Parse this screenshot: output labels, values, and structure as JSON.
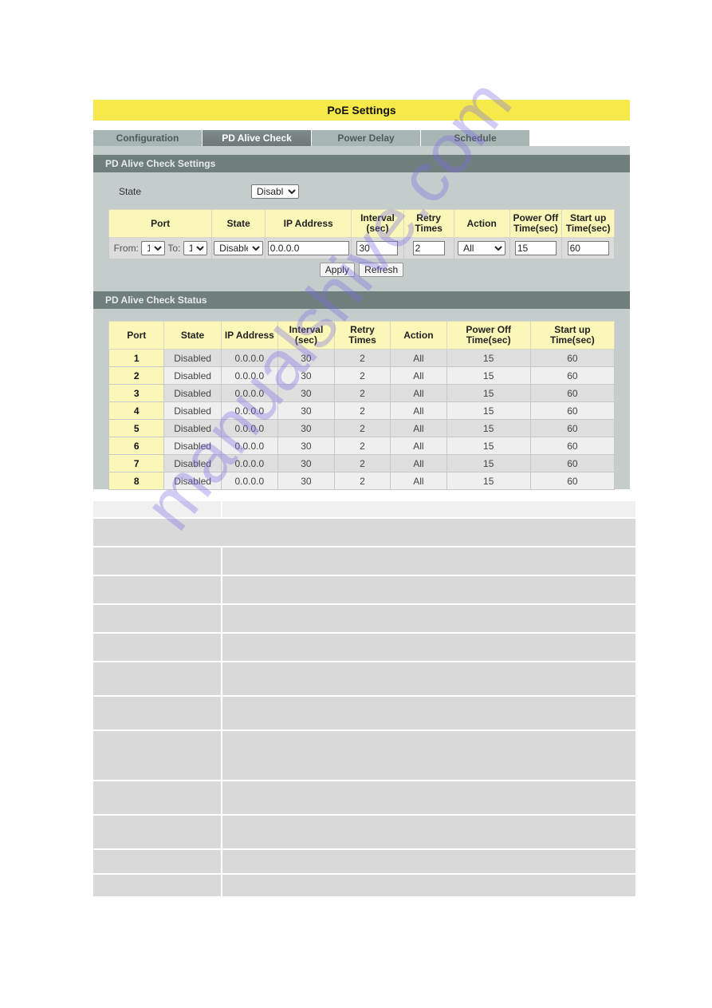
{
  "page": {
    "title": "PoE Settings"
  },
  "tabs": [
    {
      "label": "Configuration",
      "active": false
    },
    {
      "label": "PD Alive Check",
      "active": true
    },
    {
      "label": "Power Delay",
      "active": false
    },
    {
      "label": "Schedule",
      "active": false
    }
  ],
  "settings": {
    "header": "PD Alive Check Settings",
    "state_label": "State",
    "state_value": "Disable",
    "columns": [
      "Port",
      "State",
      "IP Address",
      "Interval (sec)",
      "Retry Times",
      "Action",
      "Power Off Time(sec)",
      "Start up Time(sec)"
    ],
    "columns_lines": [
      [
        "Port"
      ],
      [
        "State"
      ],
      [
        "IP Address"
      ],
      [
        "Interval",
        "(sec)"
      ],
      [
        "Retry",
        "Times"
      ],
      [
        "Action"
      ],
      [
        "Power Off",
        "Time(sec)"
      ],
      [
        "Start up",
        "Time(sec)"
      ]
    ],
    "from_label": "From:",
    "to_label": "To:",
    "from_value": "1",
    "to_value": "1",
    "row_state": "Disable",
    "ip_address": "0.0.0.0",
    "interval": "30",
    "retry_times": "2",
    "action": "All",
    "power_off_time": "15",
    "startup_time": "60",
    "apply_label": "Apply",
    "refresh_label": "Refresh"
  },
  "status": {
    "header": "PD Alive Check Status",
    "columns_lines": [
      [
        "Port"
      ],
      [
        "State"
      ],
      [
        "IP Address"
      ],
      [
        "Interval",
        "(sec)"
      ],
      [
        "Retry",
        "Times"
      ],
      [
        "Action"
      ],
      [
        "Power Off",
        "Time(sec)"
      ],
      [
        "Start up",
        "Time(sec)"
      ]
    ],
    "rows": [
      {
        "port": "1",
        "state": "Disabled",
        "ip": "0.0.0.0",
        "interval": "30",
        "retry": "2",
        "action": "All",
        "power_off": "15",
        "startup": "60"
      },
      {
        "port": "2",
        "state": "Disabled",
        "ip": "0.0.0.0",
        "interval": "30",
        "retry": "2",
        "action": "All",
        "power_off": "15",
        "startup": "60"
      },
      {
        "port": "3",
        "state": "Disabled",
        "ip": "0.0.0.0",
        "interval": "30",
        "retry": "2",
        "action": "All",
        "power_off": "15",
        "startup": "60"
      },
      {
        "port": "4",
        "state": "Disabled",
        "ip": "0.0.0.0",
        "interval": "30",
        "retry": "2",
        "action": "All",
        "power_off": "15",
        "startup": "60"
      },
      {
        "port": "5",
        "state": "Disabled",
        "ip": "0.0.0.0",
        "interval": "30",
        "retry": "2",
        "action": "All",
        "power_off": "15",
        "startup": "60"
      },
      {
        "port": "6",
        "state": "Disabled",
        "ip": "0.0.0.0",
        "interval": "30",
        "retry": "2",
        "action": "All",
        "power_off": "15",
        "startup": "60"
      },
      {
        "port": "7",
        "state": "Disabled",
        "ip": "0.0.0.0",
        "interval": "30",
        "retry": "2",
        "action": "All",
        "power_off": "15",
        "startup": "60"
      },
      {
        "port": "8",
        "state": "Disabled",
        "ip": "0.0.0.0",
        "interval": "30",
        "retry": "2",
        "action": "All",
        "power_off": "15",
        "startup": "60"
      }
    ]
  },
  "watermark": "manualshive.com",
  "colors": {
    "title_bar": "#f6ea4a",
    "header_cell": "#fbf7b8",
    "section_header": "#717e7e",
    "panel": "#c4cccc"
  }
}
